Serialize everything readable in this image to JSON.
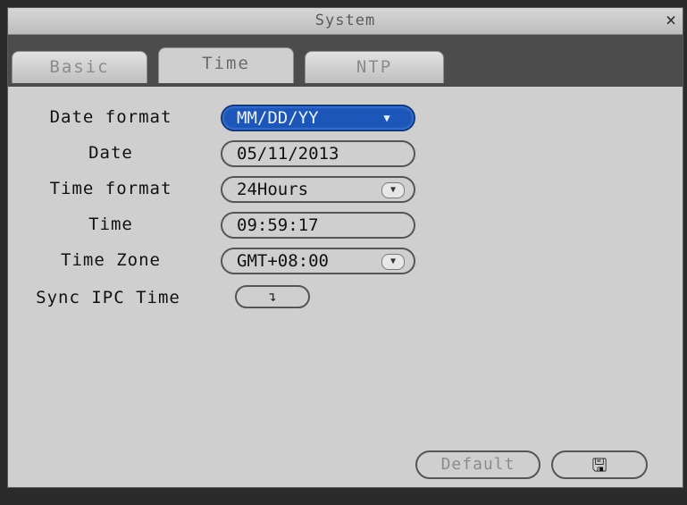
{
  "window": {
    "title": "System",
    "close_icon": "close-icon"
  },
  "tabs": [
    {
      "label": "Basic",
      "active": false
    },
    {
      "label": "Time",
      "active": true
    },
    {
      "label": "NTP",
      "active": false
    }
  ],
  "form": {
    "date_format": {
      "label": "Date format",
      "value": "MM/DD/YY",
      "icon": "chevron-down-icon"
    },
    "date": {
      "label": "Date",
      "value": "05/11/2013"
    },
    "time_format": {
      "label": "Time format",
      "value": "24Hours",
      "icon": "chevron-down-icon"
    },
    "time": {
      "label": "Time",
      "value": "09:59:17"
    },
    "time_zone": {
      "label": "Time Zone",
      "value": "GMT+08:00",
      "icon": "chevron-down-icon"
    },
    "sync_ipc_time": {
      "label": "Sync IPC Time",
      "button_icon": "enter-icon"
    }
  },
  "footer": {
    "default_label": "Default",
    "save_icon": "save-icon"
  },
  "colors": {
    "selected_field": "#1c56b8",
    "window_bg": "#cfcfcf",
    "tabbar_bg": "#4c4c4c"
  }
}
